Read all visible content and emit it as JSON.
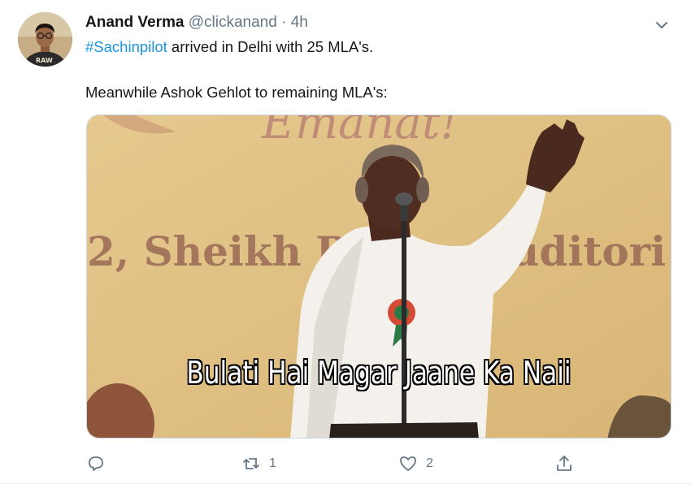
{
  "tweet": {
    "display_name": "Anand Verma",
    "handle": "@clickanand",
    "separator": "·",
    "time": "4h",
    "hashtag": "#Sachinpilot",
    "line1_rest": " arrived in Delhi with 25 MLA's.",
    "line2": "Meanwhile Ashok Gehlot to remaining MLA's:",
    "avatar_shirt_text": "RAW",
    "media": {
      "caption": "Bulati Hai Magar Jaane Ka Naii",
      "banner_top_text": "Emanat!",
      "banner_mid_left": "2, Sheikh R",
      "banner_mid_right": "uditori"
    },
    "actions": {
      "reply_icon": "reply-icon",
      "retweet_icon": "retweet-icon",
      "retweet_count": "1",
      "like_icon": "heart-icon",
      "like_count": "2",
      "share_icon": "share-icon"
    }
  },
  "colors": {
    "link": "#1b95e0",
    "secondary_text": "#657786",
    "primary_text": "#14171a",
    "border": "#ccd6dd"
  }
}
